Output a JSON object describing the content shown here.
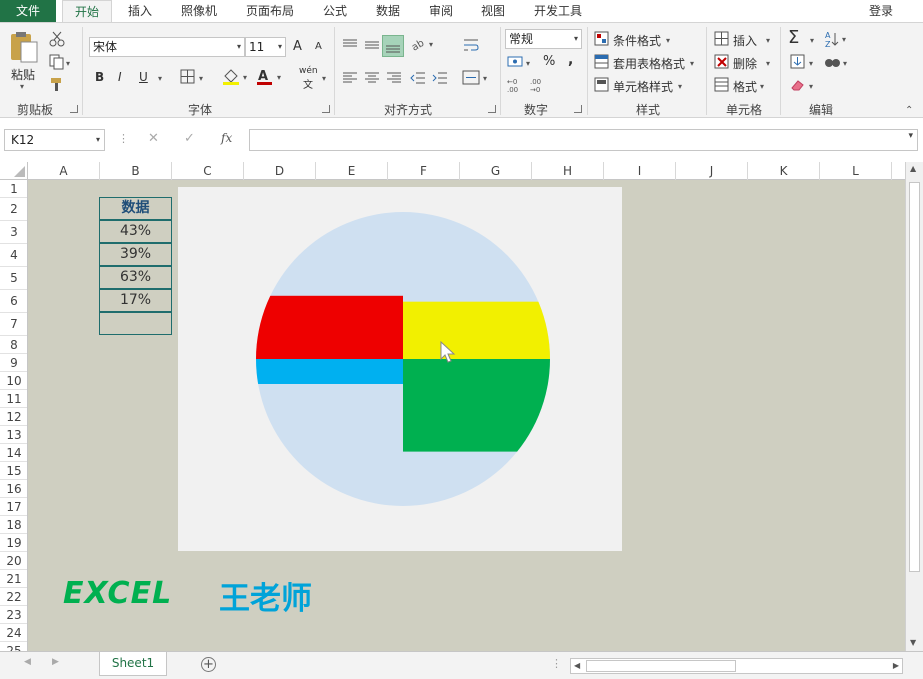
{
  "ribbon_tabs": [
    "文件",
    "开始",
    "插入",
    "照像机",
    "页面布局",
    "公式",
    "数据",
    "审阅",
    "视图",
    "开发工具"
  ],
  "active_tab": "开始",
  "login": "登录",
  "clipboard": {
    "paste_label": "粘贴",
    "group_label": "剪贴板"
  },
  "font": {
    "name": "宋体",
    "size": "11",
    "group_label": "字体",
    "bold": "B",
    "italic": "I",
    "underline": "U",
    "wen": "wén",
    "wen2": "文",
    "grow": "A",
    "shrink": "A",
    "color_letter": "A"
  },
  "alignment": {
    "group_label": "对齐方式"
  },
  "number": {
    "format": "常规",
    "group_label": "数字",
    "percent": "%",
    "comma": ","
  },
  "styles": {
    "conditional": "条件格式",
    "table_format": "套用表格格式",
    "cell_styles": "单元格样式",
    "group_label": "样式"
  },
  "cells": {
    "insert": "插入",
    "delete": "删除",
    "format": "格式",
    "group_label": "单元格"
  },
  "editing": {
    "group_label": "编辑",
    "sigma": "Σ"
  },
  "name_box": "K12",
  "fx_label": "fx",
  "columns": [
    "A",
    "B",
    "C",
    "D",
    "E",
    "F",
    "G",
    "H",
    "I",
    "J",
    "K",
    "L"
  ],
  "rows": [
    "1",
    "2",
    "3",
    "4",
    "5",
    "6",
    "7",
    "8",
    "9",
    "10",
    "11",
    "12",
    "13",
    "14",
    "15",
    "16",
    "17",
    "18",
    "19",
    "20",
    "21",
    "22",
    "23",
    "24",
    "25"
  ],
  "table": {
    "header": "数据",
    "values": [
      "43%",
      "39%",
      "63%",
      "17%",
      ""
    ]
  },
  "chart_data": {
    "type": "pie",
    "categories": [
      "",
      "",
      "",
      ""
    ],
    "values": [
      43,
      39,
      63,
      17
    ],
    "colors": [
      "#ee0000",
      "#f2f000",
      "#00b050",
      "#00b0f0"
    ],
    "background_color": "#cfe0f1"
  },
  "watermark": {
    "excel": "EXCEL",
    "teacher": "王老师"
  },
  "sheet_tab": "Sheet1",
  "colors": {
    "excel_green": "#217346",
    "grid_bg": "#cfcfc1"
  }
}
